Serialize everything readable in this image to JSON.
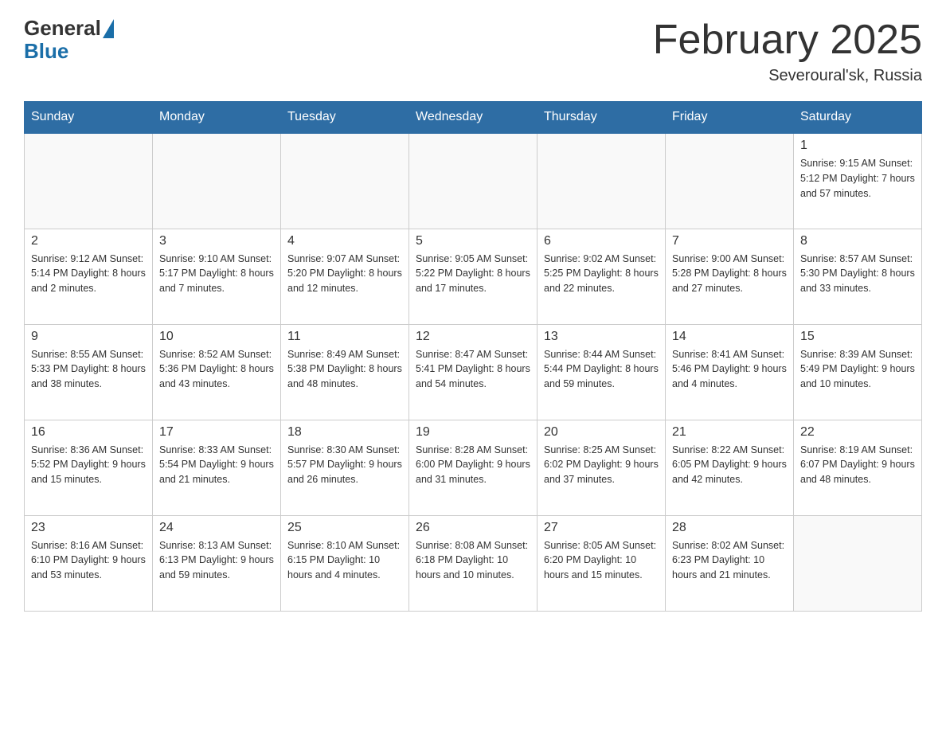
{
  "header": {
    "logo_general": "General",
    "logo_blue": "Blue",
    "title": "February 2025",
    "location": "Severoural'sk, Russia"
  },
  "days_of_week": [
    "Sunday",
    "Monday",
    "Tuesday",
    "Wednesday",
    "Thursday",
    "Friday",
    "Saturday"
  ],
  "weeks": [
    [
      {
        "day": "",
        "info": ""
      },
      {
        "day": "",
        "info": ""
      },
      {
        "day": "",
        "info": ""
      },
      {
        "day": "",
        "info": ""
      },
      {
        "day": "",
        "info": ""
      },
      {
        "day": "",
        "info": ""
      },
      {
        "day": "1",
        "info": "Sunrise: 9:15 AM\nSunset: 5:12 PM\nDaylight: 7 hours and 57 minutes."
      }
    ],
    [
      {
        "day": "2",
        "info": "Sunrise: 9:12 AM\nSunset: 5:14 PM\nDaylight: 8 hours and 2 minutes."
      },
      {
        "day": "3",
        "info": "Sunrise: 9:10 AM\nSunset: 5:17 PM\nDaylight: 8 hours and 7 minutes."
      },
      {
        "day": "4",
        "info": "Sunrise: 9:07 AM\nSunset: 5:20 PM\nDaylight: 8 hours and 12 minutes."
      },
      {
        "day": "5",
        "info": "Sunrise: 9:05 AM\nSunset: 5:22 PM\nDaylight: 8 hours and 17 minutes."
      },
      {
        "day": "6",
        "info": "Sunrise: 9:02 AM\nSunset: 5:25 PM\nDaylight: 8 hours and 22 minutes."
      },
      {
        "day": "7",
        "info": "Sunrise: 9:00 AM\nSunset: 5:28 PM\nDaylight: 8 hours and 27 minutes."
      },
      {
        "day": "8",
        "info": "Sunrise: 8:57 AM\nSunset: 5:30 PM\nDaylight: 8 hours and 33 minutes."
      }
    ],
    [
      {
        "day": "9",
        "info": "Sunrise: 8:55 AM\nSunset: 5:33 PM\nDaylight: 8 hours and 38 minutes."
      },
      {
        "day": "10",
        "info": "Sunrise: 8:52 AM\nSunset: 5:36 PM\nDaylight: 8 hours and 43 minutes."
      },
      {
        "day": "11",
        "info": "Sunrise: 8:49 AM\nSunset: 5:38 PM\nDaylight: 8 hours and 48 minutes."
      },
      {
        "day": "12",
        "info": "Sunrise: 8:47 AM\nSunset: 5:41 PM\nDaylight: 8 hours and 54 minutes."
      },
      {
        "day": "13",
        "info": "Sunrise: 8:44 AM\nSunset: 5:44 PM\nDaylight: 8 hours and 59 minutes."
      },
      {
        "day": "14",
        "info": "Sunrise: 8:41 AM\nSunset: 5:46 PM\nDaylight: 9 hours and 4 minutes."
      },
      {
        "day": "15",
        "info": "Sunrise: 8:39 AM\nSunset: 5:49 PM\nDaylight: 9 hours and 10 minutes."
      }
    ],
    [
      {
        "day": "16",
        "info": "Sunrise: 8:36 AM\nSunset: 5:52 PM\nDaylight: 9 hours and 15 minutes."
      },
      {
        "day": "17",
        "info": "Sunrise: 8:33 AM\nSunset: 5:54 PM\nDaylight: 9 hours and 21 minutes."
      },
      {
        "day": "18",
        "info": "Sunrise: 8:30 AM\nSunset: 5:57 PM\nDaylight: 9 hours and 26 minutes."
      },
      {
        "day": "19",
        "info": "Sunrise: 8:28 AM\nSunset: 6:00 PM\nDaylight: 9 hours and 31 minutes."
      },
      {
        "day": "20",
        "info": "Sunrise: 8:25 AM\nSunset: 6:02 PM\nDaylight: 9 hours and 37 minutes."
      },
      {
        "day": "21",
        "info": "Sunrise: 8:22 AM\nSunset: 6:05 PM\nDaylight: 9 hours and 42 minutes."
      },
      {
        "day": "22",
        "info": "Sunrise: 8:19 AM\nSunset: 6:07 PM\nDaylight: 9 hours and 48 minutes."
      }
    ],
    [
      {
        "day": "23",
        "info": "Sunrise: 8:16 AM\nSunset: 6:10 PM\nDaylight: 9 hours and 53 minutes."
      },
      {
        "day": "24",
        "info": "Sunrise: 8:13 AM\nSunset: 6:13 PM\nDaylight: 9 hours and 59 minutes."
      },
      {
        "day": "25",
        "info": "Sunrise: 8:10 AM\nSunset: 6:15 PM\nDaylight: 10 hours and 4 minutes."
      },
      {
        "day": "26",
        "info": "Sunrise: 8:08 AM\nSunset: 6:18 PM\nDaylight: 10 hours and 10 minutes."
      },
      {
        "day": "27",
        "info": "Sunrise: 8:05 AM\nSunset: 6:20 PM\nDaylight: 10 hours and 15 minutes."
      },
      {
        "day": "28",
        "info": "Sunrise: 8:02 AM\nSunset: 6:23 PM\nDaylight: 10 hours and 21 minutes."
      },
      {
        "day": "",
        "info": ""
      }
    ]
  ]
}
